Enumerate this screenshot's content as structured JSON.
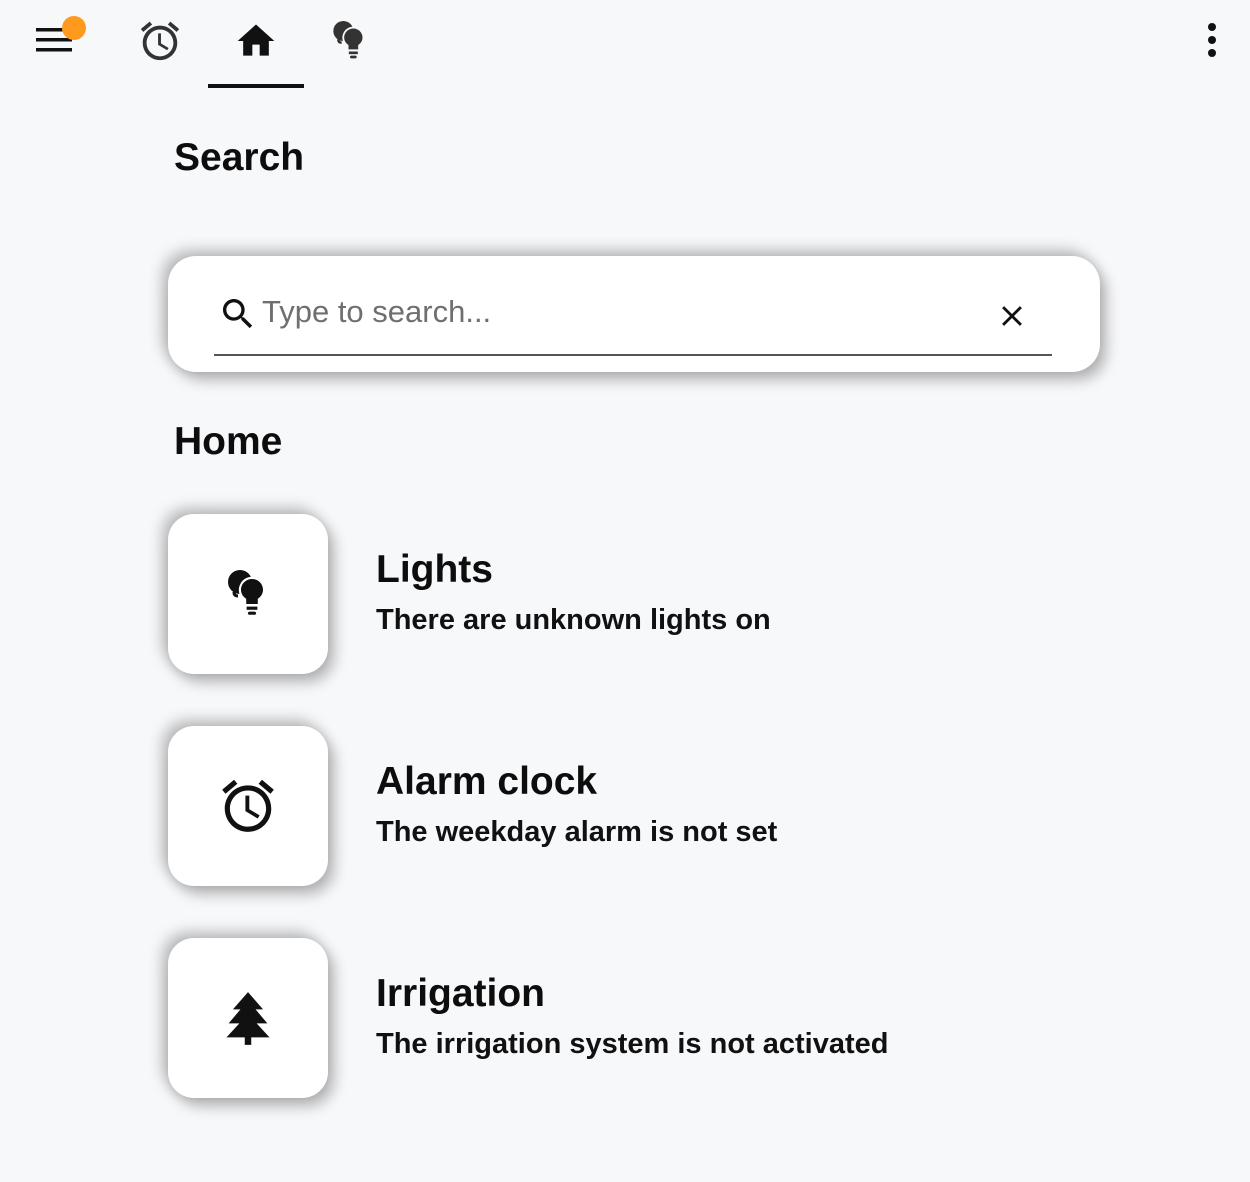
{
  "topbar": {
    "menu_icon": "menu-icon",
    "notification_color": "#ff9a1f",
    "tabs": [
      {
        "icon": "alarm-clock-icon",
        "active": false
      },
      {
        "icon": "home-icon",
        "active": true
      },
      {
        "icon": "lightbulb-group-icon",
        "active": false
      }
    ],
    "overflow_icon": "more-vertical-icon"
  },
  "search": {
    "title": "Search",
    "placeholder": "Type to search...",
    "value": "",
    "search_icon": "search-icon",
    "clear_icon": "close-icon"
  },
  "home": {
    "title": "Home",
    "items": [
      {
        "icon": "lightbulb-group-icon",
        "title": "Lights",
        "subtitle": "There are unknown lights on"
      },
      {
        "icon": "alarm-clock-icon",
        "title": "Alarm clock",
        "subtitle": "The weekday alarm is not set"
      },
      {
        "icon": "pine-tree-icon",
        "title": "Irrigation",
        "subtitle": "The irrigation system is not activated"
      }
    ]
  },
  "colors": {
    "background": "#f7f8fa",
    "card": "#ffffff",
    "badge": "#ff9a1f",
    "text": "#111111"
  }
}
